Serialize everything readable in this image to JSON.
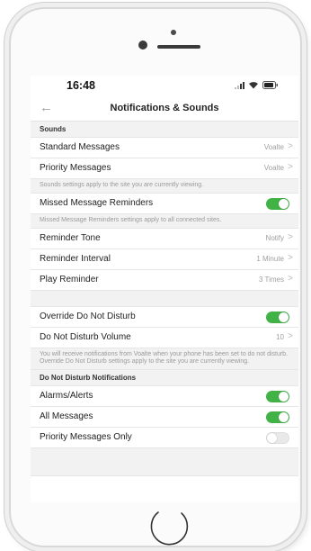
{
  "status_bar": {
    "time": "16:48"
  },
  "nav": {
    "back_icon": "arrow-left-icon",
    "title": "Notifications & Sounds"
  },
  "sounds": {
    "header": "Sounds",
    "standard_messages": {
      "label": "Standard Messages",
      "value": "Voalte"
    },
    "priority_messages": {
      "label": "Priority Messages",
      "value": "Voalte"
    },
    "note": "Sounds settings apply to the site you are currently viewing."
  },
  "missed": {
    "label": "Missed Message Reminders",
    "enabled": true,
    "note": "Missed Message Reminders settings apply to all connected sites.",
    "reminder_tone": {
      "label": "Reminder Tone",
      "value": "Notify"
    },
    "reminder_interval": {
      "label": "Reminder Interval",
      "value": "1 Minute"
    },
    "play_reminder": {
      "label": "Play Reminder",
      "value": "3 Times"
    }
  },
  "dnd": {
    "override_label": "Override Do Not Disturb",
    "override_enabled": true,
    "volume": {
      "label": "Do Not Disturb Volume",
      "value": "10"
    },
    "note_1": "You will receive notifications from Voalte when your phone has been set to do not disturb.",
    "note_2": "Override Do Not Disturb settings apply to the site you are currently viewing."
  },
  "dnd_notifications": {
    "header": "Do Not Disturb Notifications",
    "alarms": {
      "label": "Alarms/Alerts",
      "enabled": true
    },
    "all_messages": {
      "label": "All Messages",
      "enabled": true
    },
    "priority_only": {
      "label": "Priority Messages Only",
      "enabled": false
    }
  },
  "chevron": ">",
  "colors": {
    "toggle_on": "#41b246",
    "toggle_off": "#e9e9e9",
    "section_bg": "#f2f2f2"
  }
}
